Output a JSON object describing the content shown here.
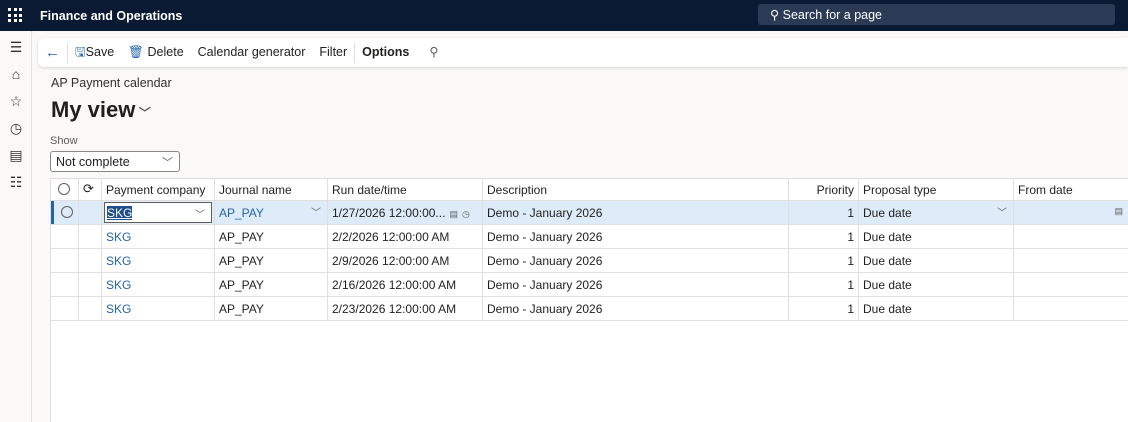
{
  "app": {
    "title": "Finance and Operations",
    "search_placeholder": "Search for a page"
  },
  "toolbar": {
    "save": "Save",
    "delete": "Delete",
    "calendar_generator": "Calendar generator",
    "filter": "Filter",
    "options": "Options"
  },
  "page": {
    "breadcrumb": "AP Payment calendar",
    "view": "My view",
    "show_label": "Show",
    "show_value": "Not complete"
  },
  "grid": {
    "headers": [
      "Payment company",
      "Journal name",
      "Run date/time",
      "Description",
      "Priority",
      "Proposal type",
      "From date"
    ],
    "rows": [
      {
        "company": "SKG",
        "journal": "AP_PAY",
        "run": "1/27/2026 12:00:00...",
        "description": "Demo - January 2026",
        "priority": "1",
        "proposal": "Due date",
        "from": ""
      },
      {
        "company": "SKG",
        "journal": "AP_PAY",
        "run": "2/2/2026 12:00:00 AM",
        "description": "Demo - January 2026",
        "priority": "1",
        "proposal": "Due date",
        "from": ""
      },
      {
        "company": "SKG",
        "journal": "AP_PAY",
        "run": "2/9/2026 12:00:00 AM",
        "description": "Demo - January 2026",
        "priority": "1",
        "proposal": "Due date",
        "from": ""
      },
      {
        "company": "SKG",
        "journal": "AP_PAY",
        "run": "2/16/2026 12:00:00 AM",
        "description": "Demo - January 2026",
        "priority": "1",
        "proposal": "Due date",
        "from": ""
      },
      {
        "company": "SKG",
        "journal": "AP_PAY",
        "run": "2/23/2026 12:00:00 AM",
        "description": "Demo - January 2026",
        "priority": "1",
        "proposal": "Due date",
        "from": ""
      }
    ]
  }
}
